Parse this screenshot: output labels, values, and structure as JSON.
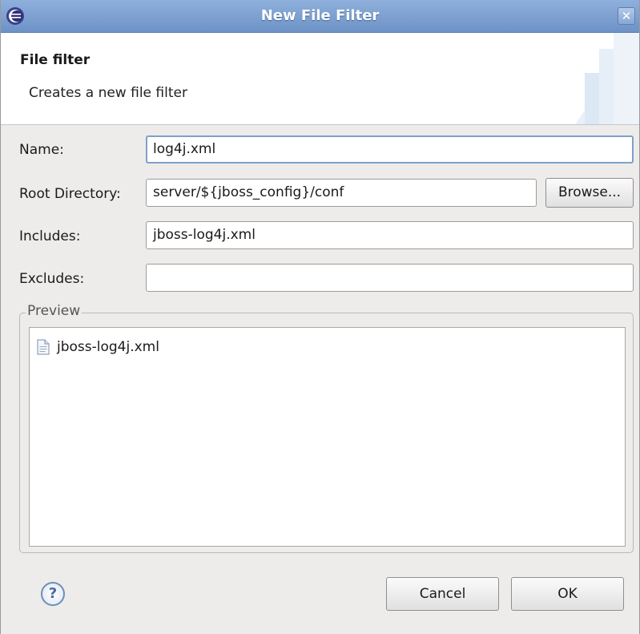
{
  "window": {
    "title": "New File Filter",
    "close_glyph": "✕",
    "icons": {
      "app": "eclipse-icon",
      "close": "close-icon"
    }
  },
  "banner": {
    "title": "File filter",
    "description": "Creates a new file filter"
  },
  "form": {
    "name": {
      "label": "Name:",
      "value": "log4j.xml"
    },
    "root_directory": {
      "label": "Root Directory:",
      "value": "server/${jboss_config}/conf"
    },
    "browse_label": "Browse...",
    "includes": {
      "label": "Includes:",
      "value": "jboss-log4j.xml"
    },
    "excludes": {
      "label": "Excludes:",
      "value": ""
    }
  },
  "preview": {
    "legend": "Preview",
    "items": [
      {
        "label": "jboss-log4j.xml",
        "icon": "file-icon"
      }
    ]
  },
  "footer": {
    "help_glyph": "?",
    "cancel_label": "Cancel",
    "ok_label": "OK"
  },
  "colors": {
    "titlebar": "#7c9fd2",
    "dialog_bg": "#edeceb",
    "focus_border": "#7fa0c9"
  }
}
